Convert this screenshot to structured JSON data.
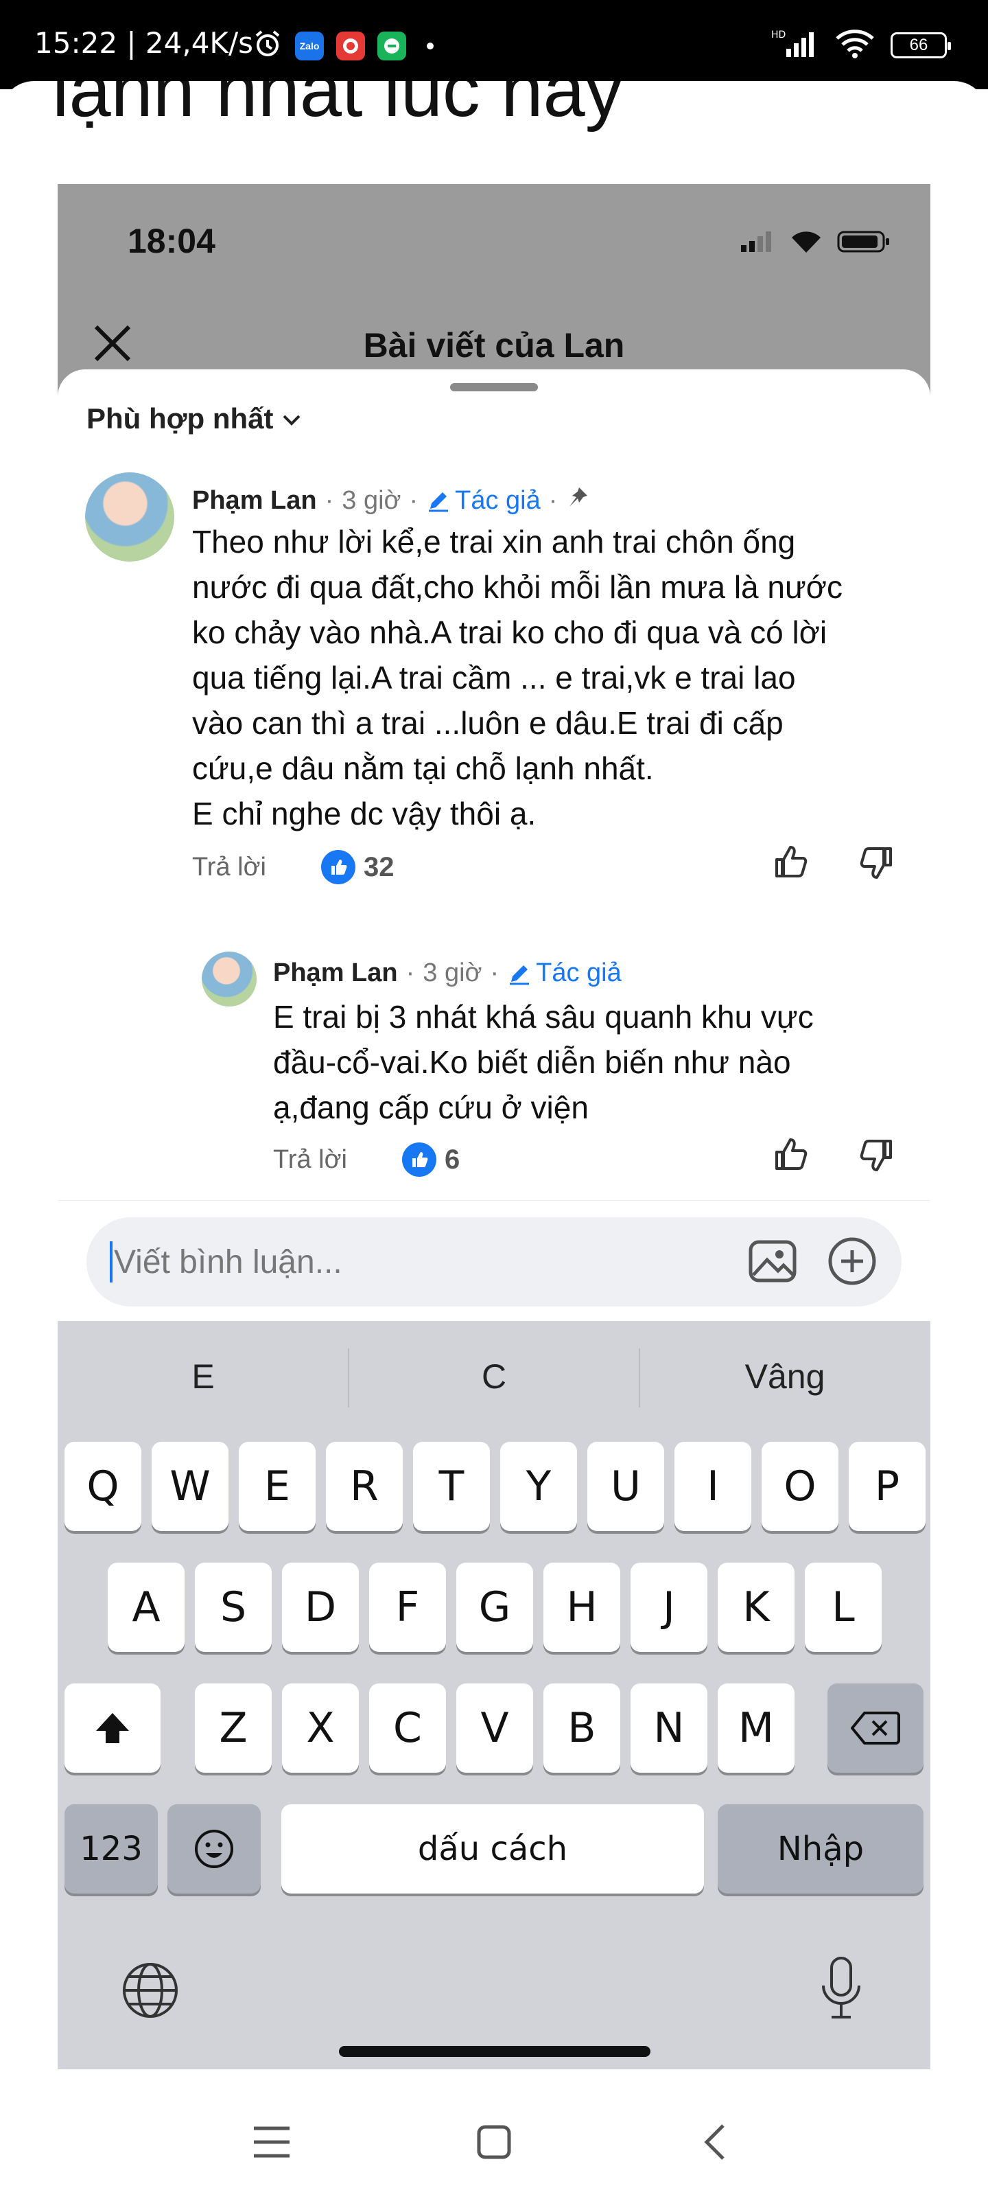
{
  "status_bar": {
    "time": "15:22",
    "speed": "24,4K/s",
    "battery": "66",
    "network": "HD"
  },
  "background_caption": "lạnh nhất lúc này",
  "inner": {
    "time": "18:04",
    "title": "Bài viết của Lan",
    "sort_label": "Phù hợp nhất"
  },
  "comments": [
    {
      "name": "Phạm Lan",
      "time": "3 giờ",
      "badge": "Tác giả",
      "body": "Theo như lời kể,e trai xin anh trai chôn ống\nnước đi qua đất,cho khỏi mỗi lần mưa là nước\nko chảy vào nhà.A trai ko cho đi qua và có lời\nqua tiếng lại.A trai cầm ... e trai,vk e trai  lao\nvào can thì a trai ...luôn e dâu.E trai đi cấp\ncứu,e dâu nằm tại chỗ lạnh nhất.\nE chỉ nghe dc vậy thôi ạ.",
      "reply": "Trả lời",
      "likes": "32"
    },
    {
      "name": "Phạm Lan",
      "time": "3 giờ",
      "badge": "Tác giả",
      "body": "E trai bị 3 nhát khá sâu quanh khu vực\nđầu-cổ-vai.Ko biết diễn biến như nào\nạ,đang cấp cứu ở viện",
      "reply": "Trả lời",
      "likes": "6"
    }
  ],
  "comment_input": {
    "placeholder": "Viết bình luận..."
  },
  "keyboard": {
    "suggestions": [
      "E",
      "C",
      "Vâng"
    ],
    "row1": [
      "Q",
      "W",
      "E",
      "R",
      "T",
      "Y",
      "U",
      "I",
      "O",
      "P"
    ],
    "row2": [
      "A",
      "S",
      "D",
      "F",
      "G",
      "H",
      "J",
      "K",
      "L"
    ],
    "row3": [
      "Z",
      "X",
      "C",
      "V",
      "B",
      "N",
      "M"
    ],
    "num_key": "123",
    "space": "dấu cách",
    "enter": "Nhập"
  },
  "colors": {
    "accent": "#1877f2",
    "keyboard_bg": "#d1d3d9"
  }
}
